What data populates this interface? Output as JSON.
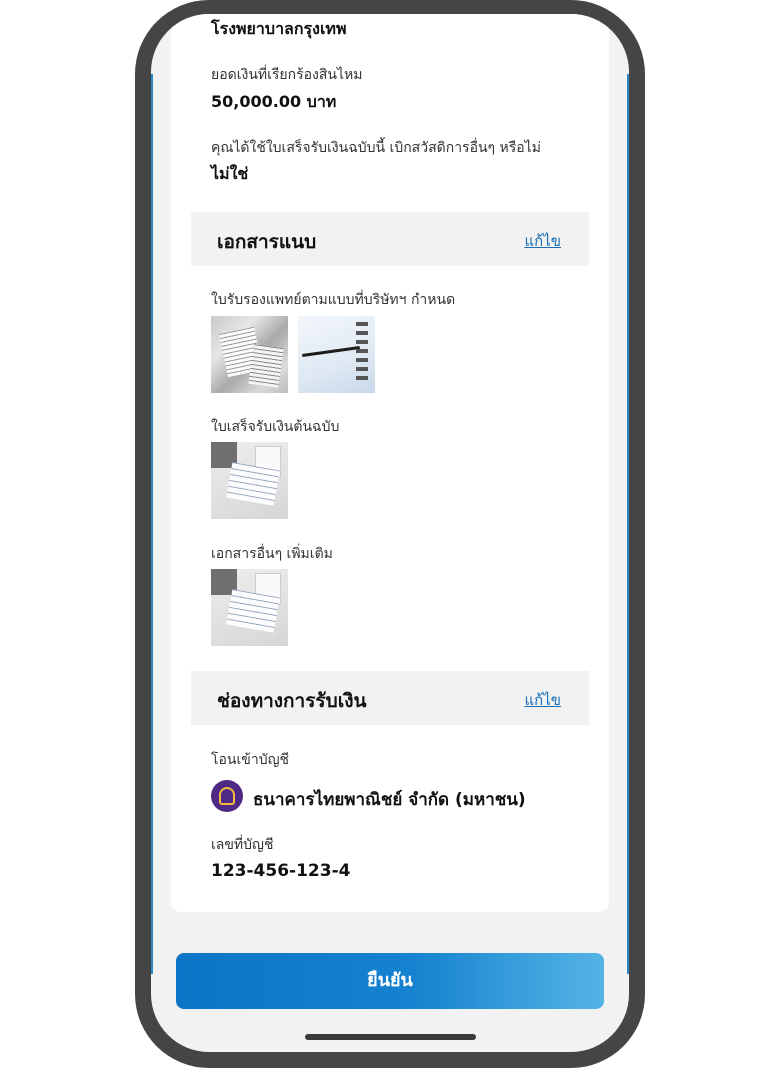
{
  "hospital": {
    "name": "โรงพยาบาลกรุงเทพ"
  },
  "claim": {
    "amount_label": "ยอดเงินที่เรียกร้องสินไหม",
    "amount_value": "50,000.00 บาท",
    "reuse_question": "คุณได้ใช้ใบเสร็จรับเงินฉบับนี้ เบิกสวัสดิการอื่นๆ หรือไม่",
    "reuse_answer": "ไม่ใช่"
  },
  "attachments": {
    "title": "เอกสารแนบ",
    "edit_label": "แก้ไข",
    "groups": [
      {
        "label": "ใบรับรองแพทย์ตามแบบที่บริษัทฯ กำหนด"
      },
      {
        "label": "ใบเสร็จรับเงินต้นฉบับ"
      },
      {
        "label": "เอกสารอื่นๆ เพิ่มเติม"
      }
    ]
  },
  "payment": {
    "title": "ช่องทางการรับเงิน",
    "edit_label": "แก้ไข",
    "method_label": "โอนเข้าบัญชี",
    "bank_icon": "scb-bank-logo-icon",
    "bank_name": "ธนาคารไทยพาณิชย์ จำกัด (มหาชน)",
    "account_label": "เลขที่บัญชี",
    "account_number": "123-456-123-4"
  },
  "actions": {
    "confirm_label": "ยืนยัน"
  },
  "colors": {
    "primary": "#0c74c6",
    "primary_light": "#55b4e6",
    "link": "#1a6fb8",
    "bank_brand": "#4e2a84"
  }
}
